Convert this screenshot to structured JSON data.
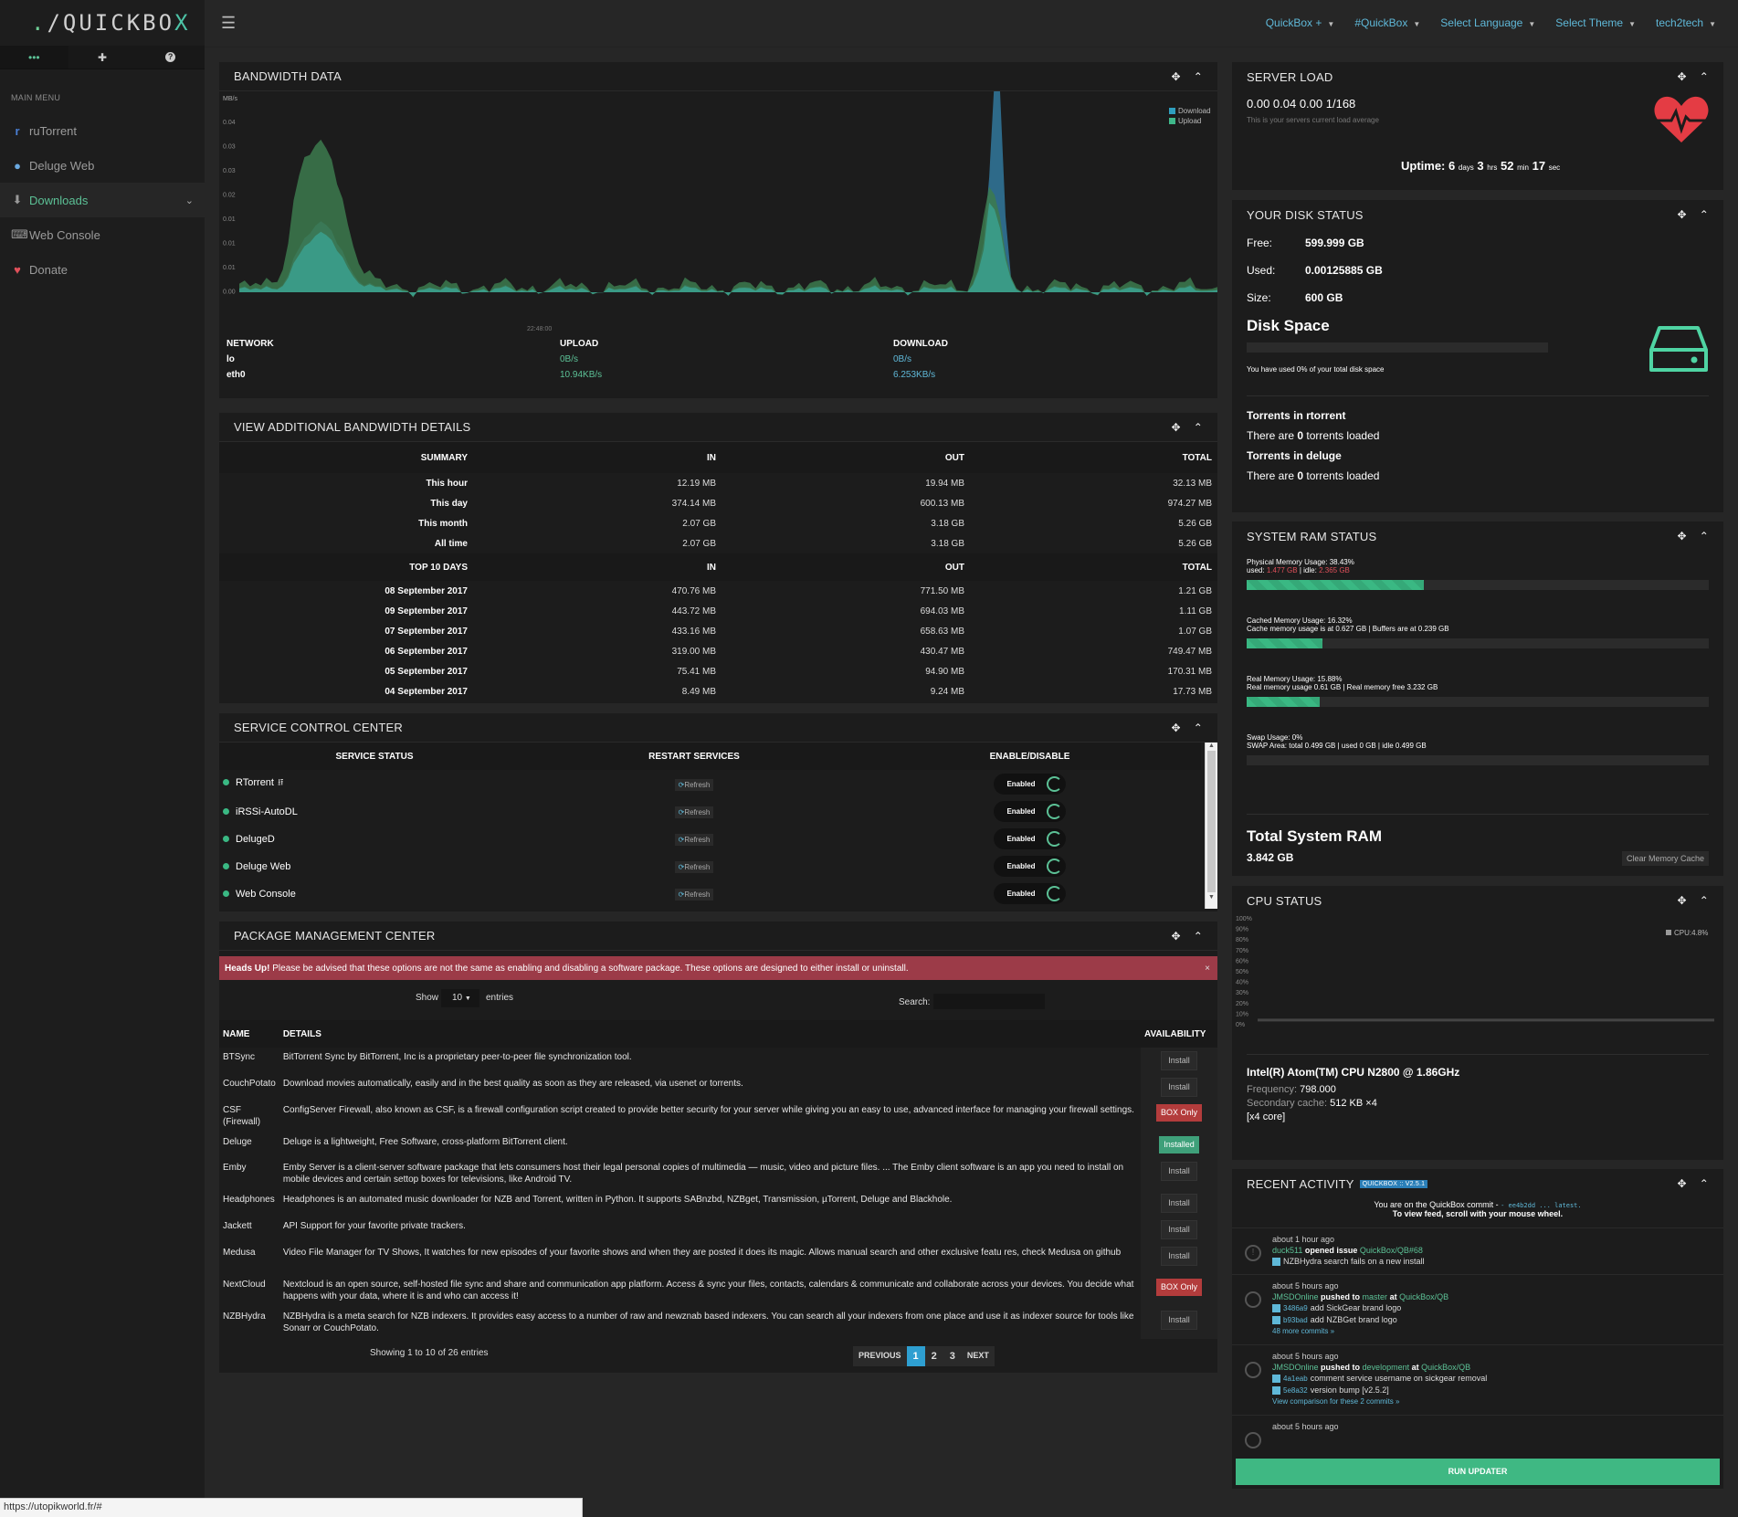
{
  "sidebar": {
    "logo": {
      "prefix": ".",
      "slash": "/",
      "text": "QUICKBO",
      "x": "X"
    },
    "tabs": [
      "•••",
      "✚",
      "?"
    ],
    "main_menu_label": "MAIN MENU",
    "items": [
      {
        "label": "ruTorrent",
        "icon": "rutorrent-icon"
      },
      {
        "label": "Deluge Web",
        "icon": "deluge-icon"
      },
      {
        "label": "Downloads",
        "icon": "download-icon",
        "active": true
      },
      {
        "label": "Web Console",
        "icon": "keyboard-icon"
      },
      {
        "label": "Donate",
        "icon": "heart-icon"
      }
    ]
  },
  "topnav": [
    "QuickBox +",
    "#QuickBox",
    "Select Language",
    "Select Theme",
    "tech2tech"
  ],
  "bandwidth": {
    "title": "BANDWIDTH DATA",
    "unit": "MB/s",
    "yticks": [
      "0.04",
      "0.03",
      "0.03",
      "0.02",
      "0.01",
      "0.01",
      "0.01",
      "0.00"
    ],
    "xtick": "22:48:00",
    "legend": [
      "Download",
      "Upload"
    ],
    "colors": {
      "download": "#2f6f8f",
      "upload": "#3c7a4e",
      "overlap": "#3a9a86"
    },
    "table": {
      "headers": [
        "NETWORK",
        "UPLOAD",
        "DOWNLOAD"
      ],
      "rows": [
        {
          "name": "lo",
          "up": "0B/s",
          "down": "0B/s"
        },
        {
          "name": "eth0",
          "up": "10.94KB/s",
          "down": "6.253KB/s"
        }
      ]
    }
  },
  "bw_details": {
    "title": "VIEW ADDITIONAL BANDWIDTH DETAILS",
    "summary_headers": [
      "SUMMARY",
      "IN",
      "OUT",
      "TOTAL"
    ],
    "summary": [
      [
        "This hour",
        "12.19 MB",
        "19.94 MB",
        "32.13 MB"
      ],
      [
        "This day",
        "374.14 MB",
        "600.13 MB",
        "974.27 MB"
      ],
      [
        "This month",
        "2.07 GB",
        "3.18 GB",
        "5.26 GB"
      ],
      [
        "All time",
        "2.07 GB",
        "3.18 GB",
        "5.26 GB"
      ]
    ],
    "top_headers": [
      "TOP 10 DAYS",
      "IN",
      "OUT",
      "TOTAL"
    ],
    "top": [
      [
        "08 September 2017",
        "470.76 MB",
        "771.50 MB",
        "1.21 GB"
      ],
      [
        "09 September 2017",
        "443.72 MB",
        "694.03 MB",
        "1.11 GB"
      ],
      [
        "07 September 2017",
        "433.16 MB",
        "658.63 MB",
        "1.07 GB"
      ],
      [
        "06 September 2017",
        "319.00 MB",
        "430.47 MB",
        "749.47 MB"
      ],
      [
        "05 September 2017",
        "75.41 MB",
        "94.90 MB",
        "170.31 MB"
      ],
      [
        "04 September 2017",
        "8.49 MB",
        "9.24 MB",
        "17.73 MB"
      ]
    ]
  },
  "services": {
    "title": "SERVICE CONTROL CENTER",
    "headers": [
      "SERVICE STATUS",
      "RESTART SERVICES",
      "ENABLE/DISABLE"
    ],
    "refresh_label": "Refresh",
    "enabled_label": "Enabled",
    "items": [
      "RTorrent",
      "iRSSi-AutoDL",
      "DelugeD",
      "Deluge Web",
      "Web Console"
    ]
  },
  "packages": {
    "title": "PACKAGE MANAGEMENT CENTER",
    "alert_bold": "Heads Up!",
    "alert_text": "Please be advised that these options are not the same as enabling and disabling a software package. These options are designed to either install or uninstall.",
    "show_label": "Show",
    "show_value": "10",
    "entries_label": "entries",
    "search_label": "Search:",
    "headers": [
      "NAME",
      "DETAILS",
      "AVAILABILITY"
    ],
    "rows": [
      {
        "name": "BTSync",
        "details": "BitTorrent Sync by BitTorrent, Inc is a proprietary peer-to-peer file synchronization tool.",
        "status": "Install"
      },
      {
        "name": "CouchPotato",
        "details": "Download movies automatically, easily and in the best quality as soon as they are released, via usenet or torrents.",
        "status": "Install"
      },
      {
        "name": "CSF (Firewall)",
        "details": "ConfigServer Firewall, also known as CSF, is a firewall configuration script created to provide better security for your server while giving you an easy to use, advanced interface for managing your firewall settings.",
        "status": "BOX Only"
      },
      {
        "name": "Deluge",
        "details": "Deluge is a lightweight, Free Software, cross-platform BitTorrent client.",
        "status": "Installed"
      },
      {
        "name": "Emby",
        "details": "Emby Server is a client-server software package that lets consumers host their legal personal copies of multimedia — music, video and picture files. ... The Emby client software is an app you need to install on mobile devices and certain settop boxes for televisions, like Android TV.",
        "status": "Install"
      },
      {
        "name": "Headphones",
        "details": "Headphones is an automated music downloader for NZB and Torrent, written in Python. It supports SABnzbd, NZBget, Transmission, µTorrent, Deluge and Blackhole.",
        "status": "Install"
      },
      {
        "name": "Jackett",
        "details": "API Support for your favorite private trackers.",
        "status": "Install"
      },
      {
        "name": "Medusa",
        "details": "Video File Manager for TV Shows, It watches for new episodes of your favorite shows and when they are posted it does its magic. Allows manual search and other exclusive featu res, check Medusa on github",
        "status": "Install"
      },
      {
        "name": "NextCloud",
        "details": "Nextcloud is an open source, self-hosted file sync and share and communication app platform. Access & sync your files, contacts, calendars & communicate and collaborate across your devices. You decide what happens with your data, where it is and who can access it!",
        "status": "BOX Only"
      },
      {
        "name": "NZBHydra",
        "details": "NZBHydra is a meta search for NZB indexers. It provides easy access to a number of raw and newznab based indexers. You can search all your indexers from one place and use it as indexer source for tools like Sonarr or CouchPotato.",
        "status": "Install"
      }
    ],
    "showing": "Showing 1 to 10 of 26 entries",
    "pager": [
      "PREVIOUS",
      "1",
      "2",
      "3",
      "NEXT"
    ]
  },
  "server_load": {
    "title": "SERVER LOAD",
    "value": "0.00 0.04 0.00 1/168",
    "sub": "This is your servers current load average",
    "uptime_label": "Uptime:",
    "uptime": [
      "6",
      "days",
      "3",
      "hrs",
      "52",
      "min",
      "17",
      "sec"
    ]
  },
  "disk": {
    "title": "YOUR DISK STATUS",
    "free_label": "Free:",
    "free": "599.999 GB",
    "used_label": "Used:",
    "used": "0.00125885 GB",
    "size_label": "Size:",
    "size": "600 GB",
    "space_title": "Disk Space",
    "used_pct": 0,
    "note": "You have used 0% of your total disk space",
    "rt_title": "Torrents in rtorrent",
    "rt_pre": "There are",
    "rt_count": "0",
    "rt_post": "torrents loaded",
    "dl_title": "Torrents in deluge",
    "dl_pre": "There are",
    "dl_count": "0",
    "dl_post": "torrents loaded"
  },
  "ram": {
    "title": "SYSTEM RAM STATUS",
    "physical": {
      "l1": "Physical Memory Usage: 38.43%",
      "used_label": "used:",
      "used": "1.477 GB",
      "idle_label": "idle:",
      "idle": "2.365 GB",
      "pct": 38.43
    },
    "cached": {
      "l1": "Cached Memory Usage: 16.32%",
      "l2": "Cache memory usage is at 0.627 GB | Buffers are at 0.239 GB",
      "pct": 16.32
    },
    "real": {
      "l1": "Real Memory Usage: 15.88%",
      "l2": "Real memory usage 0.61 GB | Real memory free 3.232 GB",
      "pct": 15.88
    },
    "swap": {
      "l1": "Swap Usage: 0%",
      "l2": "SWAP Area: total 0.499 GB | used 0 GB | idle 0.499 GB",
      "pct": 0
    },
    "total_title": "Total System RAM",
    "total": "3.842 GB",
    "clear_btn": "Clear Memory Cache"
  },
  "cpu": {
    "title": "CPU STATUS",
    "yticks": [
      "100%",
      "90%",
      "80%",
      "70%",
      "60%",
      "50%",
      "40%",
      "30%",
      "20%",
      "10%",
      "0%"
    ],
    "legend": "CPU:4.8%",
    "cpu_pct": 4.8,
    "model": "Intel(R) Atom(TM) CPU N2800 @ 1.86GHz",
    "freq_label": "Frequency:",
    "freq": "798.000",
    "cache_label": "Secondary cache:",
    "cache": "512 KB ×4",
    "cores": "[x4 core]"
  },
  "activity": {
    "title": "RECENT ACTIVITY",
    "badge": "QUICKBOX :: V2.5.1",
    "line1_pre": "You are on the QuickBox commit -",
    "line1_hash": "- ee4b2dd ... latest.",
    "line2": "To view feed, scroll with your mouse wheel.",
    "items": [
      {
        "time": "about 1 hour ago",
        "user": "duck511",
        "action": "opened issue",
        "target": "QuickBox/QB#68",
        "details": [
          {
            "hash": "",
            "msg": "NZBHydra search fails on a new install"
          }
        ],
        "more": ""
      },
      {
        "time": "about 5 hours ago",
        "user": "JMSDOnline",
        "action": "pushed to",
        "branch": "master",
        "at": "at",
        "target": "QuickBox/QB",
        "details": [
          {
            "hash": "3486a9",
            "msg": "add SickGear brand logo"
          },
          {
            "hash": "b93bad",
            "msg": "add NZBGet brand logo"
          }
        ],
        "more": "48 more commits »"
      },
      {
        "time": "about 5 hours ago",
        "user": "JMSDOnline",
        "action": "pushed to",
        "branch": "development",
        "at": "at",
        "target": "QuickBox/QB",
        "details": [
          {
            "hash": "4a1eab",
            "msg": "comment service username on sickgear removal"
          },
          {
            "hash": "5e8a32",
            "msg": "version bump [v2.5.2]"
          }
        ],
        "more": "View comparison for these 2 commits »"
      },
      {
        "time": "about 5 hours ago",
        "user": "",
        "action": "",
        "target": "",
        "details": [],
        "more": ""
      }
    ],
    "run_updater": "RUN UPDATER"
  },
  "statusbar": {
    "url": "https://utopikworld.fr/#"
  }
}
